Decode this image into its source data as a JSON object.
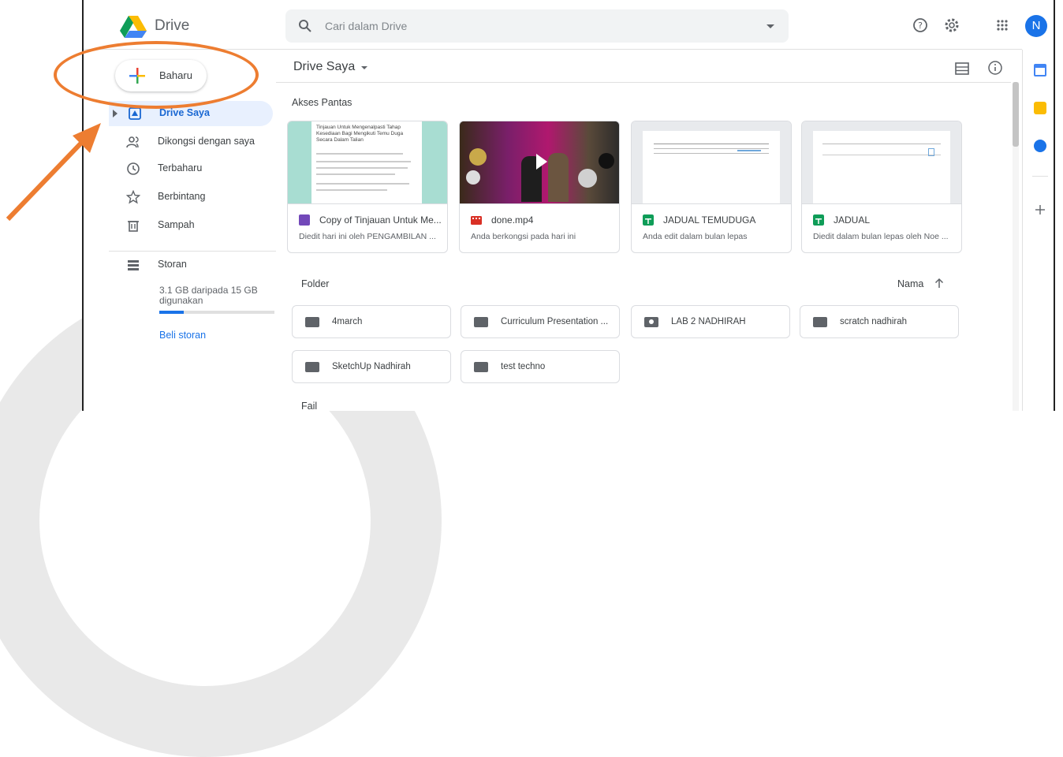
{
  "app": {
    "title": "Drive"
  },
  "search": {
    "placeholder": "Cari dalam Drive"
  },
  "header": {
    "avatar_letter": "N"
  },
  "sidebar": {
    "new_label": "Baharu",
    "items": [
      {
        "label": "Drive Saya",
        "icon": "my-drive-icon"
      },
      {
        "label": "Dikongsi dengan saya",
        "icon": "shared-icon"
      },
      {
        "label": "Terbaharu",
        "icon": "clock-icon"
      },
      {
        "label": "Berbintang",
        "icon": "star-icon"
      },
      {
        "label": "Sampah",
        "icon": "trash-icon"
      }
    ],
    "storage_label": "Storan",
    "storage_used": "3.1 GB daripada 15 GB digunakan",
    "storage_fraction": 0.21,
    "buy_label": "Beli storan"
  },
  "main": {
    "title": "Drive Saya",
    "quick_access_label": "Akses Pantas",
    "quick_access": [
      {
        "name": "Copy of Tinjauan Untuk Me...",
        "sub": "Diedit hari ini oleh PENGAMBILAN ...",
        "type": "form",
        "color": "#7248b9",
        "preview": "Tinjauan Untuk Mengenalpasti Tahap Kesediaan Bagi Mengikuti Temu Duga Secara Dalam Talian"
      },
      {
        "name": "done.mp4",
        "sub": "Anda berkongsi pada hari ini",
        "type": "video",
        "color": "#d93025"
      },
      {
        "name": "JADUAL TEMUDUGA",
        "sub": "Anda edit dalam bulan lepas",
        "type": "sheet",
        "color": "#0f9d58"
      },
      {
        "name": "JADUAL",
        "sub": "Diedit dalam bulan lepas oleh Noe ...",
        "type": "sheet",
        "color": "#0f9d58"
      }
    ],
    "folder_label": "Folder",
    "sort_label": "Nama",
    "folders": [
      {
        "name": "4march",
        "shared": false
      },
      {
        "name": "Curriculum Presentation ...",
        "shared": false
      },
      {
        "name": "LAB 2 NADHIRAH",
        "shared": true
      },
      {
        "name": "scratch nadhirah",
        "shared": false
      },
      {
        "name": "SketchUp Nadhirah",
        "shared": false
      },
      {
        "name": "test techno",
        "shared": false
      }
    ],
    "files_label": "Fail"
  }
}
